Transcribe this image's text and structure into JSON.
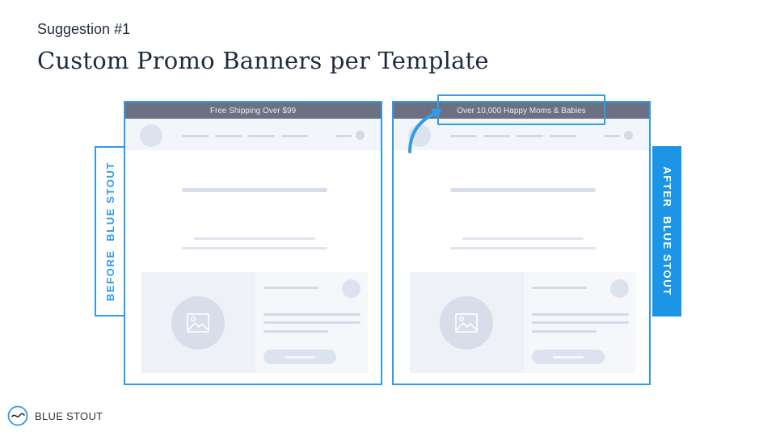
{
  "slide": {
    "eyebrow": "Suggestion #1",
    "title": "Custom Promo Banners per Template"
  },
  "before": {
    "banner_text": "Free Shipping Over $99",
    "side_label": "BEFORE  BLUE STOUT"
  },
  "after": {
    "banner_text": "Over 10,000 Happy Moms & Babies",
    "side_label": "AFTER  BLUE STOUT"
  },
  "brand": {
    "name": "BLUE STOUT",
    "logo_icon": "wave-circle-icon"
  },
  "colors": {
    "accent": "#2f9bea",
    "banner_bg": "#6b7083",
    "title_text": "#1f2b3d"
  }
}
